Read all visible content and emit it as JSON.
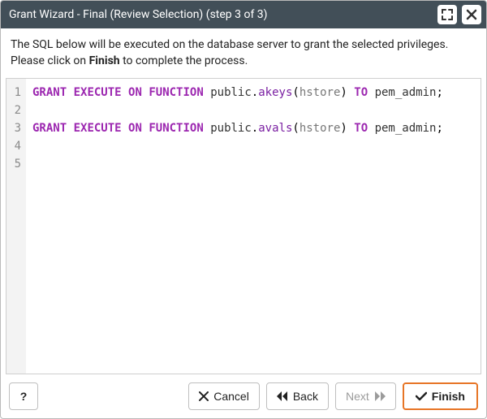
{
  "title": "Grant Wizard - Final (Review Selection) (step 3 of 3)",
  "instruction_pre": "The SQL below will be executed on the database server to grant the selected privileges. Please click on ",
  "instruction_bold": "Finish",
  "instruction_post": " to complete the process.",
  "code_lines": [
    {
      "n": "1",
      "tokens": [
        {
          "t": "GRANT",
          "c": "kw"
        },
        {
          "t": " "
        },
        {
          "t": "EXECUTE",
          "c": "kw"
        },
        {
          "t": " "
        },
        {
          "t": "ON",
          "c": "kw"
        },
        {
          "t": " "
        },
        {
          "t": "FUNCTION",
          "c": "kw"
        },
        {
          "t": " "
        },
        {
          "t": "public",
          "c": "sch"
        },
        {
          "t": "."
        },
        {
          "t": "akeys",
          "c": "fn"
        },
        {
          "t": "("
        },
        {
          "t": "hstore",
          "c": "typ"
        },
        {
          "t": ")"
        },
        {
          "t": " "
        },
        {
          "t": "TO",
          "c": "kw"
        },
        {
          "t": " "
        },
        {
          "t": "pem_admin",
          "c": "id"
        },
        {
          "t": ";"
        }
      ]
    },
    {
      "n": "2",
      "tokens": []
    },
    {
      "n": "3",
      "tokens": [
        {
          "t": "GRANT",
          "c": "kw"
        },
        {
          "t": " "
        },
        {
          "t": "EXECUTE",
          "c": "kw"
        },
        {
          "t": " "
        },
        {
          "t": "ON",
          "c": "kw"
        },
        {
          "t": " "
        },
        {
          "t": "FUNCTION",
          "c": "kw"
        },
        {
          "t": " "
        },
        {
          "t": "public",
          "c": "sch"
        },
        {
          "t": "."
        },
        {
          "t": "avals",
          "c": "fn"
        },
        {
          "t": "("
        },
        {
          "t": "hstore",
          "c": "typ"
        },
        {
          "t": ")"
        },
        {
          "t": " "
        },
        {
          "t": "TO",
          "c": "kw"
        },
        {
          "t": " "
        },
        {
          "t": "pem_admin",
          "c": "id"
        },
        {
          "t": ";"
        }
      ]
    },
    {
      "n": "4",
      "tokens": []
    },
    {
      "n": "5",
      "tokens": []
    }
  ],
  "buttons": {
    "help": "?",
    "cancel": "Cancel",
    "back": "Back",
    "next": "Next",
    "finish": "Finish"
  }
}
